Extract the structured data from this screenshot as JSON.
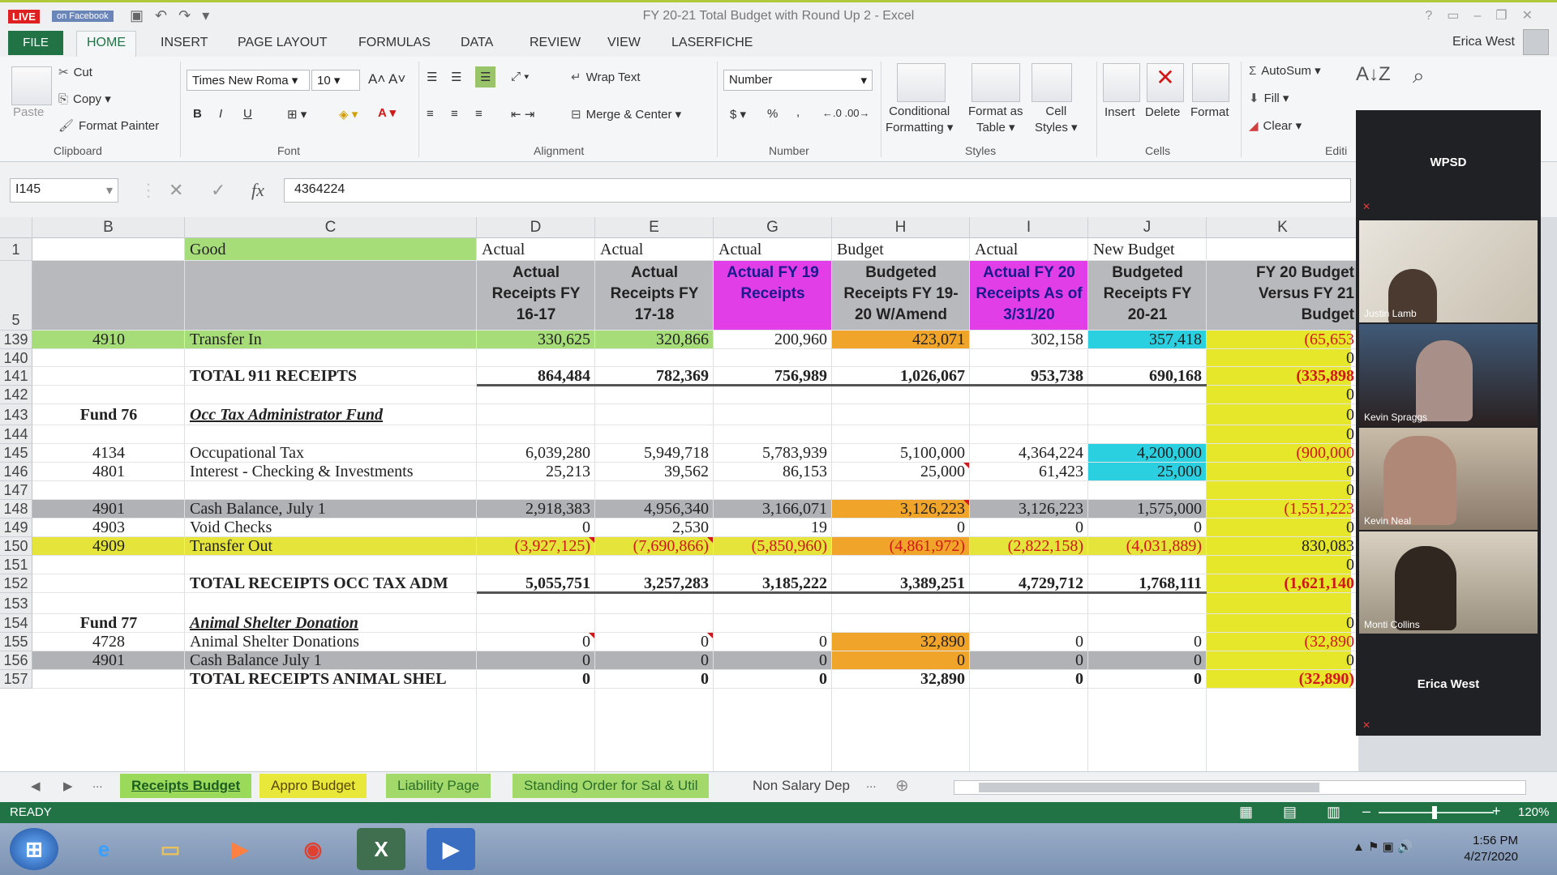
{
  "titlebar": {
    "live": "LIVE",
    "fb": "on Facebook",
    "title": "FY 20-21 Total Budget with Round Up 2 - Excel"
  },
  "menu": {
    "file": "FILE",
    "tabs": [
      "HOME",
      "INSERT",
      "PAGE LAYOUT",
      "FORMULAS",
      "DATA",
      "REVIEW",
      "VIEW",
      "LASERFICHE"
    ],
    "user": "Erica West"
  },
  "ribbon": {
    "paste": "Paste",
    "cut": "Cut",
    "copy": "Copy",
    "format_painter": "Format Painter",
    "font_name": "Times New Roma",
    "font_size": "10",
    "bold": "B",
    "italic": "I",
    "underline": "U",
    "wrap_text": "Wrap Text",
    "merge_center": "Merge & Center",
    "number_format": "Number",
    "dollar": "$",
    "percent": "%",
    "comma": ",",
    "conditional": "Conditional",
    "formatting": "Formatting",
    "format_as": "Format as",
    "table": "Table",
    "cell": "Cell",
    "styles": "Styles",
    "insert": "Insert",
    "delete": "Delete",
    "format": "Format",
    "autosum": "AutoSum",
    "fill": "Fill",
    "clear": "Clear",
    "groups": {
      "clipboard": "Clipboard",
      "font": "Font",
      "alignment": "Alignment",
      "number": "Number",
      "styles": "Styles",
      "cells": "Cells",
      "editing": "Editi"
    }
  },
  "formula": {
    "name_box": "I145",
    "value": "4364224",
    "fx": "fx"
  },
  "columns": [
    "B",
    "C",
    "D",
    "E",
    "G",
    "H",
    "I",
    "J",
    "K"
  ],
  "header_rows": {
    "row1": {
      "num": "1",
      "C": "Good",
      "D": "Actual",
      "E": "Actual",
      "G": "Actual",
      "H": "Budget",
      "I": "Actual",
      "J": "New Budget"
    },
    "row5": {
      "num": "5",
      "D": "Actual Receipts FY 16-17",
      "E": "Actual Receipts FY 17-18",
      "G": "Actual FY 19 Receipts",
      "H": "Budgeted Receipts FY 19-20 W/Amend",
      "I": "Actual FY 20 Receipts As of 3/31/20",
      "J": "Budgeted Receipts FY 20-21",
      "K": "FY 20 Budget Versus FY 21 Budget"
    }
  },
  "rows": [
    {
      "num": "139",
      "B": "4910",
      "C": "Transfer In",
      "D": "330,625",
      "E": "320,866",
      "G": "200,960",
      "H": "423,071",
      "I": "302,158",
      "J": "357,418",
      "K": "(65,653"
    },
    {
      "num": "140",
      "K": "0"
    },
    {
      "num": "141",
      "C": "TOTAL  911 RECEIPTS",
      "D": "864,484",
      "E": "782,369",
      "G": "756,989",
      "H": "1,026,067",
      "I": "953,738",
      "J": "690,168",
      "K": "(335,898"
    },
    {
      "num": "142",
      "K": "0"
    },
    {
      "num": "143",
      "B": "Fund 76",
      "C": "Occ Tax Administrator Fund",
      "K": "0"
    },
    {
      "num": "144",
      "K": "0"
    },
    {
      "num": "145",
      "B": "4134",
      "C": "Occupational Tax",
      "D": "6,039,280",
      "E": "5,949,718",
      "G": "5,783,939",
      "H": "5,100,000",
      "I": "4,364,224",
      "J": "4,200,000",
      "K": "(900,000"
    },
    {
      "num": "146",
      "B": "4801",
      "C": "Interest - Checking & Investments",
      "D": "25,213",
      "E": "39,562",
      "G": "86,153",
      "H": "25,000",
      "I": "61,423",
      "J": "25,000",
      "K": "0"
    },
    {
      "num": "147",
      "K": "0"
    },
    {
      "num": "148",
      "B": "4901",
      "C": "Cash Balance, July 1",
      "D": "2,918,383",
      "E": "4,956,340",
      "G": "3,166,071",
      "H": "3,126,223",
      "I": "3,126,223",
      "J": "1,575,000",
      "K": "(1,551,223"
    },
    {
      "num": "149",
      "B": "4903",
      "C": "Void Checks",
      "D": "0",
      "E": "2,530",
      "G": "19",
      "H": "0",
      "I": "0",
      "J": "0",
      "K": "0"
    },
    {
      "num": "150",
      "B": "4909",
      "C": "Transfer Out",
      "D": "(3,927,125)",
      "E": "(7,690,866)",
      "G": "(5,850,960)",
      "H": "(4,861,972)",
      "I": "(2,822,158)",
      "J": "(4,031,889)",
      "K": "830,083"
    },
    {
      "num": "151",
      "K": "0"
    },
    {
      "num": "152",
      "C": "TOTAL RECEIPTS OCC TAX ADM",
      "D": "5,055,751",
      "E": "3,257,283",
      "G": "3,185,222",
      "H": "3,389,251",
      "I": "4,729,712",
      "J": "1,768,111",
      "K": "(1,621,140"
    },
    {
      "num": "153"
    },
    {
      "num": "154",
      "B": "Fund 77",
      "C": "Animal Shelter Donation",
      "K": "0"
    },
    {
      "num": "155",
      "B": "4728",
      "C": "Animal Shelter Donations",
      "D": "0",
      "E": "0",
      "G": "0",
      "H": "32,890",
      "I": "0",
      "J": "0",
      "K": "(32,890"
    },
    {
      "num": "156",
      "B": "4901",
      "C": "Cash Balance July 1",
      "D": "0",
      "E": "0",
      "G": "0",
      "H": "0",
      "I": "0",
      "J": "0",
      "K": "0"
    },
    {
      "num": "157",
      "C": "TOTAL RECEIPTS ANIMAL SHEL",
      "D": "0",
      "E": "0",
      "G": "0",
      "H": "32,890",
      "I": "0",
      "J": "0",
      "K": "(32,890)"
    }
  ],
  "sheets": {
    "nav_more": "...",
    "tabs": [
      "Receipts Budget",
      "Appro Budget",
      "Liability Page",
      "Standing Order for Sal & Util",
      "Non Salary Dep"
    ],
    "more": "..."
  },
  "status": {
    "ready": "READY",
    "zoom": "120%"
  },
  "taskbar": {
    "time": "1:56 PM",
    "date": "4/27/2020"
  },
  "zoom_panel": {
    "top_label": "WPSD",
    "participants": [
      "Justin Lamb",
      "Kevin Spraggs",
      "Kevin Neal",
      "Monti Collins"
    ],
    "bottom_label": "Erica West"
  },
  "colors": {
    "excel_green": "#217346",
    "light_green": "#9ad95a",
    "magenta": "#e23ee8",
    "orange": "#f0a52a",
    "cyan": "#2ad0e0",
    "yellow": "#e6e62a",
    "gray": "#b7b9bd"
  }
}
